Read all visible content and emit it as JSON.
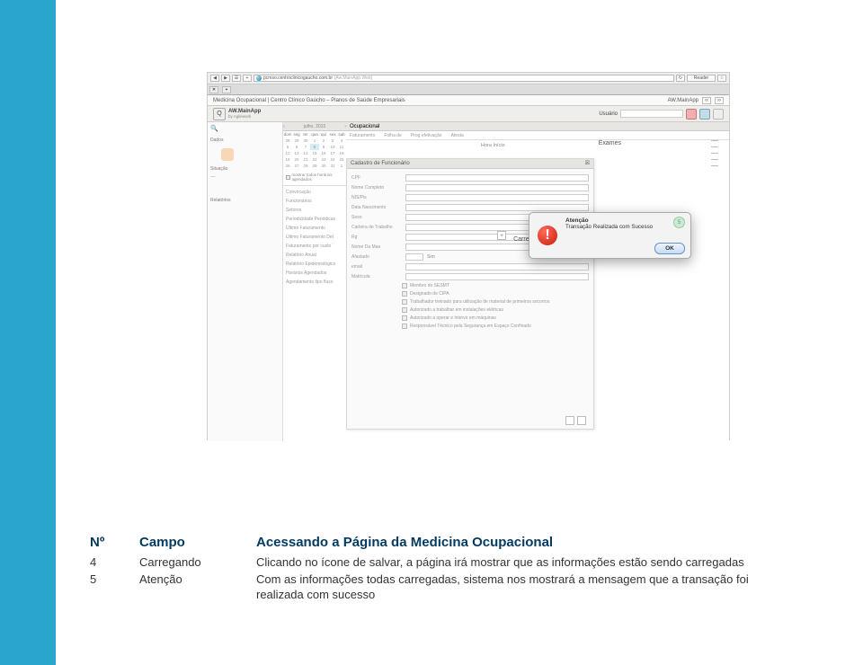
{
  "browser": {
    "url": "pcmso.centroclinicogaucho.com.br",
    "url_suffix": "[Aw.MainApp.Web]",
    "reader": "Reader"
  },
  "breadcrumb": "Medicina Ocupacional | Centro Clínico Gaúcho – Planos de Saúde Empresariais",
  "breadcrumb_right": "AW.MainApp",
  "app": {
    "name": "AW.MainApp",
    "by": "by Agilework",
    "user_label": "Usuário"
  },
  "left": {
    "datos": "Dados",
    "situacao": "Situação",
    "relatorios": "Relatórios"
  },
  "calendar": {
    "month": "julho, 2015",
    "dow": [
      "dom",
      "seg",
      "ter",
      "qua",
      "qui",
      "sex",
      "sab"
    ],
    "cells": [
      "28",
      "29",
      "30",
      "1",
      "2",
      "3",
      "4",
      "5",
      "6",
      "7",
      "8",
      "9",
      "10",
      "11",
      "12",
      "13",
      "14",
      "15",
      "16",
      "17",
      "18",
      "19",
      "20",
      "21",
      "22",
      "23",
      "24",
      "25",
      "26",
      "27",
      "28",
      "29",
      "30",
      "31",
      "1"
    ],
    "checkbox": "mostrar todos horários agendados"
  },
  "mid_items": [
    "Convocação",
    "Funcionários",
    "Setores",
    "Periodicidade Periódicas",
    "Último Faturamento",
    "Último Faturamento Det",
    "Faturamento por custo",
    "Relatório Anual",
    "Relatório Epidemiológico",
    "Horários Agendados",
    "Agendamento tipo fluxo"
  ],
  "main": {
    "title": "Ocupacional"
  },
  "tabs": [
    "Faturamento",
    "Folha de",
    "Prog efetivação",
    "Atesta"
  ],
  "exams": "Exames",
  "hora": "Hora Início",
  "cadastro": {
    "title": "Cadastro de Funcionário",
    "fields": {
      "cpf": "CPF",
      "nome": "Nome Completo",
      "nis": "NIS/Pis",
      "data": "Data Nascimento",
      "sexo": "Sexo",
      "carteira": "Carteira de Trabalho",
      "rg": "Rg",
      "mae": "Nome Da Mae",
      "afastado": "Afastado",
      "sim": "Sim",
      "email": "email",
      "matricula": "Matrícula"
    },
    "checks": [
      "Membro do SESMT",
      "Designado de CIPA",
      "Trabalhador treinado para utilização de material de primeiros socorros",
      "Autorizado a trabalhar em instalações elétricas",
      "Autorizado a operar e intervir em máquinas",
      "Responsável Técnico pela Segurança em Espaço Confinado"
    ]
  },
  "loading": "Carregando...",
  "alert": {
    "title": "Atenção",
    "msg": "Transação Realizada com Sucesso",
    "count": "5",
    "ok": "OK"
  },
  "table": {
    "h1": "Nº",
    "h2": "Campo",
    "h3": "Acessando a Página da Medicina Ocupacional",
    "rows": [
      {
        "n": "4",
        "c": "Carregando",
        "d": "Clicando no ícone de salvar, a página irá mostrar que as informações estão sendo carregadas"
      },
      {
        "n": "5",
        "c": "Atenção",
        "d": "Com as informações todas carregadas, sistema nos mostrará a mensagem que a transação foi realizada com sucesso"
      }
    ]
  }
}
